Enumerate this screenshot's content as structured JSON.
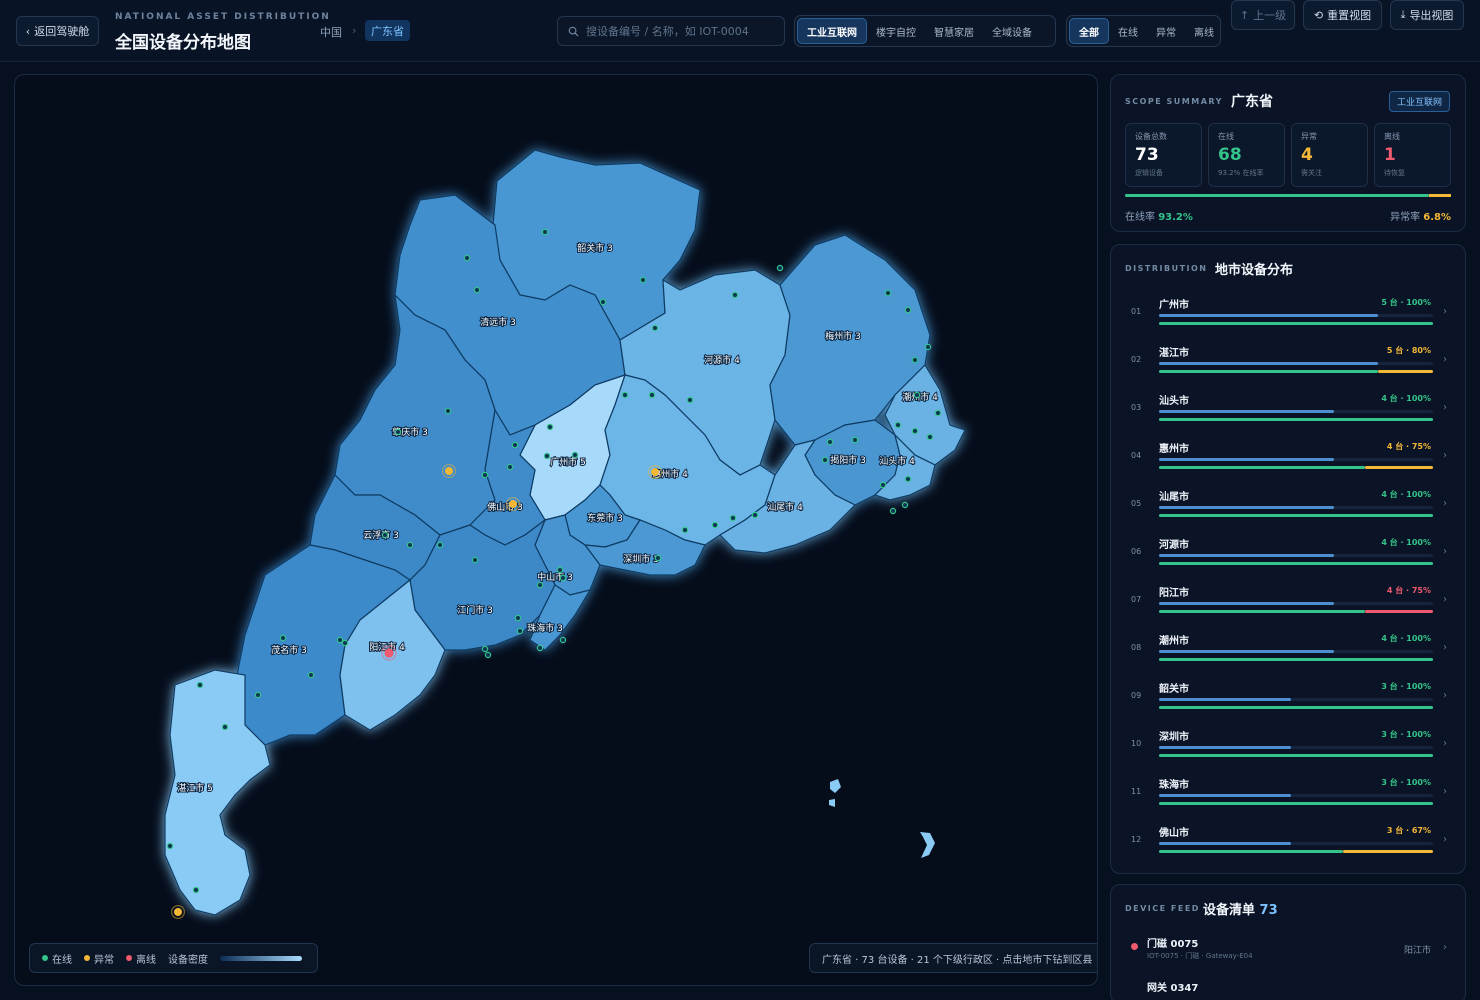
{
  "header": {
    "back_label": "返回驾驶舱",
    "brand_sub": "NATIONAL ASSET DISTRIBUTION",
    "brand_title": "全国设备分布地图",
    "breadcrumb": [
      "中国",
      "广东省"
    ],
    "search_placeholder": "搜设备编号 / 名称，如 IOT-0004",
    "scenes": [
      {
        "label": "工业互联网",
        "active": true
      },
      {
        "label": "楼宇自控",
        "active": false
      },
      {
        "label": "智慧家居",
        "active": false
      },
      {
        "label": "全域设备",
        "active": false
      }
    ],
    "status_filters": [
      {
        "label": "全部",
        "active": true
      },
      {
        "label": "在线",
        "active": false
      },
      {
        "label": "异常",
        "active": false
      },
      {
        "label": "离线",
        "active": false
      }
    ],
    "up_label": "上一级",
    "reset_label": "重置视图",
    "export_label": "导出视图"
  },
  "map": {
    "regions": [
      {
        "name": "韶关市",
        "count": 3
      },
      {
        "name": "清远市",
        "count": 3
      },
      {
        "name": "河源市",
        "count": 4
      },
      {
        "name": "梅州市",
        "count": 3
      },
      {
        "name": "潮州市",
        "count": 4
      },
      {
        "name": "肇庆市",
        "count": 3
      },
      {
        "name": "广州市",
        "count": 5
      },
      {
        "name": "惠州市",
        "count": 4
      },
      {
        "name": "揭阳市",
        "count": 3
      },
      {
        "name": "汕头市",
        "count": 4
      },
      {
        "name": "佛山市",
        "count": 3
      },
      {
        "name": "东莞市",
        "count": 3
      },
      {
        "name": "汕尾市",
        "count": 4
      },
      {
        "name": "云浮市",
        "count": 3
      },
      {
        "name": "深圳市",
        "count": 3
      },
      {
        "name": "中山市",
        "count": 3
      },
      {
        "name": "江门市",
        "count": 3
      },
      {
        "name": "珠海市",
        "count": 3
      },
      {
        "name": "茂名市",
        "count": 3
      },
      {
        "name": "阳江市",
        "count": 4
      },
      {
        "name": "湛江市",
        "count": 5
      }
    ],
    "legend": {
      "online": "在线",
      "abnormal": "异常",
      "offline": "离线",
      "density": "设备密度"
    },
    "caption": "广东省 · 73 台设备 · 21 个下级行政区 · 点击地市下钻到区县",
    "colors": {
      "online": "#34c48a",
      "abnormal": "#f4b736",
      "offline": "#ef5a6f"
    }
  },
  "summary": {
    "eyebrow": "SCOPE SUMMARY",
    "title": "广东省",
    "badge": "工业互联网",
    "stats": [
      {
        "label": "设备总数",
        "value": "73",
        "note": "逻辑设备",
        "color": "#ffffff"
      },
      {
        "label": "在线",
        "value": "68",
        "note": "93.2% 在线率",
        "color": "#34c48a"
      },
      {
        "label": "异常",
        "value": "4",
        "note": "需关注",
        "color": "#f4b736"
      },
      {
        "label": "离线",
        "value": "1",
        "note": "待恢复",
        "color": "#ef5a6f"
      }
    ],
    "online_rate_label": "在线率",
    "online_rate": "93.2%",
    "abnormal_rate_label": "异常率",
    "abnormal_rate": "6.8%",
    "online_fraction": 0.932
  },
  "distribution": {
    "eyebrow": "DISTRIBUTION",
    "title": "地市设备分布",
    "rows": [
      {
        "idx": "01",
        "name": "广州市",
        "value": "5 台 · 100%",
        "share": 1.0,
        "online": 1.0,
        "status": "online"
      },
      {
        "idx": "02",
        "name": "湛江市",
        "value": "5 台 · 80%",
        "share": 1.0,
        "online": 0.8,
        "status": "abnormal"
      },
      {
        "idx": "03",
        "name": "汕头市",
        "value": "4 台 · 100%",
        "share": 0.8,
        "online": 1.0,
        "status": "online"
      },
      {
        "idx": "04",
        "name": "惠州市",
        "value": "4 台 · 75%",
        "share": 0.8,
        "online": 0.75,
        "status": "abnormal"
      },
      {
        "idx": "05",
        "name": "汕尾市",
        "value": "4 台 · 100%",
        "share": 0.8,
        "online": 1.0,
        "status": "online"
      },
      {
        "idx": "06",
        "name": "河源市",
        "value": "4 台 · 100%",
        "share": 0.8,
        "online": 1.0,
        "status": "online"
      },
      {
        "idx": "07",
        "name": "阳江市",
        "value": "4 台 · 75%",
        "share": 0.8,
        "online": 0.75,
        "status": "offline"
      },
      {
        "idx": "08",
        "name": "潮州市",
        "value": "4 台 · 100%",
        "share": 0.8,
        "online": 1.0,
        "status": "online"
      },
      {
        "idx": "09",
        "name": "韶关市",
        "value": "3 台 · 100%",
        "share": 0.6,
        "online": 1.0,
        "status": "online"
      },
      {
        "idx": "10",
        "name": "深圳市",
        "value": "3 台 · 100%",
        "share": 0.6,
        "online": 1.0,
        "status": "online"
      },
      {
        "idx": "11",
        "name": "珠海市",
        "value": "3 台 · 100%",
        "share": 0.6,
        "online": 1.0,
        "status": "online"
      },
      {
        "idx": "12",
        "name": "佛山市",
        "value": "3 台 · 67%",
        "share": 0.6,
        "online": 0.67,
        "status": "abnormal"
      }
    ]
  },
  "feed": {
    "eyebrow": "DEVICE FEED",
    "title": "设备清单",
    "count": "73",
    "items": [
      {
        "name": "门磁 0075",
        "meta": "IOT-0075 · 门磁 · Gateway-E04",
        "city": "阳江市",
        "status": "offline"
      },
      {
        "name": "网关 0347",
        "meta": "",
        "city": "",
        "status": "online"
      }
    ]
  }
}
